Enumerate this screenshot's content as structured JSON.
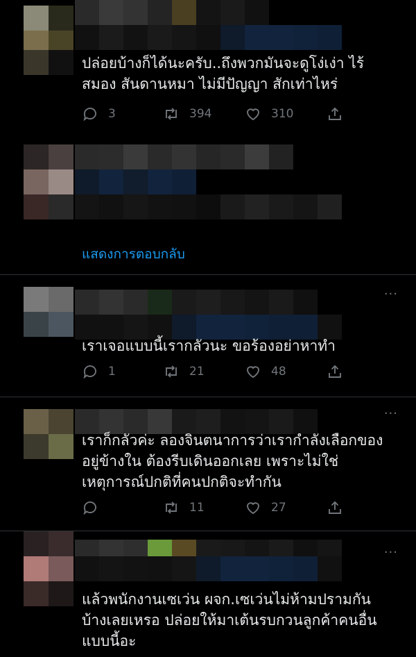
{
  "tweets": [
    {
      "text": "ปล่อยบ้างก็ได้นะครับ..ถึงพวกมันจะดูโง่เง่า ไร้\nสมอง สันดานหมา ไม่มีปัญญา สักเท่าไหร่",
      "replies": "3",
      "retweets": "394",
      "likes": "310"
    },
    {
      "text": "เราเจอแบบนี้เรากลัวนะ ขอร้องอย่าหาทำ",
      "replies": "1",
      "retweets": "21",
      "likes": "48"
    },
    {
      "text": "เราก็กลัวค่ะ ลองจินตนาการว่าเรากำลังเลือกของ\nอยู่ข้างใน ต้องรีบเดินออกเลย เพราะไม่ใช่\nเหตุการณ์ปกติที่คนปกติจะทำกัน",
      "replies": "",
      "retweets": "11",
      "likes": "27"
    },
    {
      "text": "แล้วพนักงานเซเว่น ผจก.เซเว่นไม่ห้ามปรามกัน\nบ้างเลยเหรอ ปล่อยให้มาเต้นรบกวนลูกค้าคนอื่น\nแบบนี้อะ"
    }
  ],
  "show_replies": "แสดงการตอบกลับ",
  "more_glyph": "···",
  "icons": [
    "reply-icon",
    "retweet-icon",
    "like-icon",
    "share-icon"
  ]
}
